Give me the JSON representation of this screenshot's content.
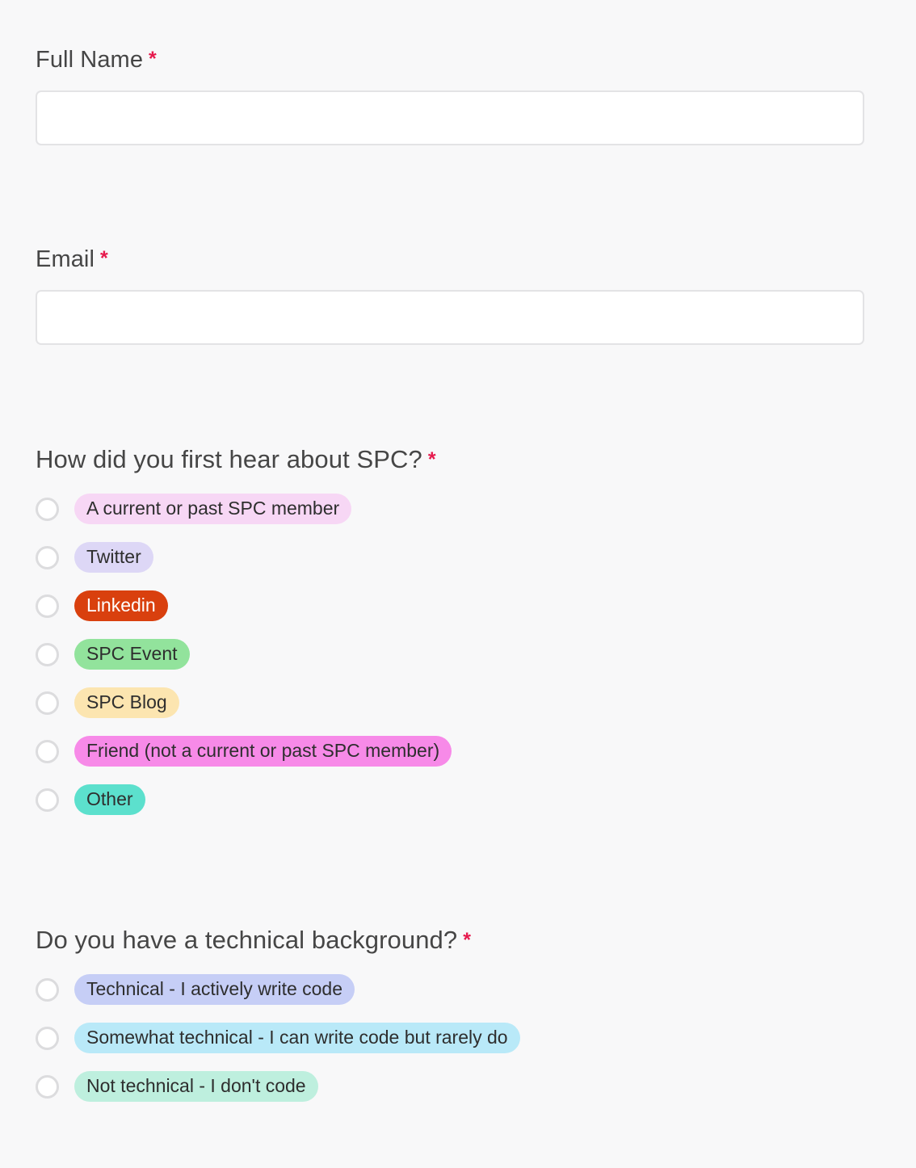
{
  "colors": {
    "page_background": "#f8f8f9",
    "label_text": "#464646",
    "required_asterisk": "#e61a4d",
    "input_border": "#e3e3e5",
    "input_background": "#ffffff",
    "radio_border": "#dcdcde",
    "pill_text_default": "#2e2e2e"
  },
  "required_marker": "*",
  "fields": [
    {
      "name": "full_name",
      "label": "Full Name",
      "required": true,
      "value": "",
      "placeholder": ""
    },
    {
      "name": "email",
      "label": "Email",
      "required": true,
      "value": "",
      "placeholder": ""
    }
  ],
  "questions": [
    {
      "name": "how_did_you_hear",
      "label": "How did you first hear about SPC?",
      "required": true,
      "selected": null,
      "options": [
        {
          "label": "A current or past SPC member",
          "bg": "#f7d7f5",
          "fg": "#2e2e2e"
        },
        {
          "label": "Twitter",
          "bg": "#ddd7f6",
          "fg": "#2e2e2e"
        },
        {
          "label": "Linkedin",
          "bg": "#d9400e",
          "fg": "#ffffff"
        },
        {
          "label": "SPC Event",
          "bg": "#92e39c",
          "fg": "#2e2e2e"
        },
        {
          "label": "SPC Blog",
          "bg": "#fce5b0",
          "fg": "#2e2e2e"
        },
        {
          "label": "Friend (not a current or past SPC member)",
          "bg": "#f78ae8",
          "fg": "#2e2e2e"
        },
        {
          "label": "Other",
          "bg": "#5ce0cd",
          "fg": "#2e2e2e"
        }
      ]
    },
    {
      "name": "technical_background",
      "label": "Do you have a technical background?",
      "required": true,
      "selected": null,
      "options": [
        {
          "label": "Technical - I actively write code",
          "bg": "#c6cef6",
          "fg": "#2e2e2e"
        },
        {
          "label": "Somewhat technical - I can write code but rarely do",
          "bg": "#b9e9f8",
          "fg": "#2e2e2e"
        },
        {
          "label": "Not technical - I don't code",
          "bg": "#beefde",
          "fg": "#2e2e2e"
        }
      ]
    }
  ]
}
